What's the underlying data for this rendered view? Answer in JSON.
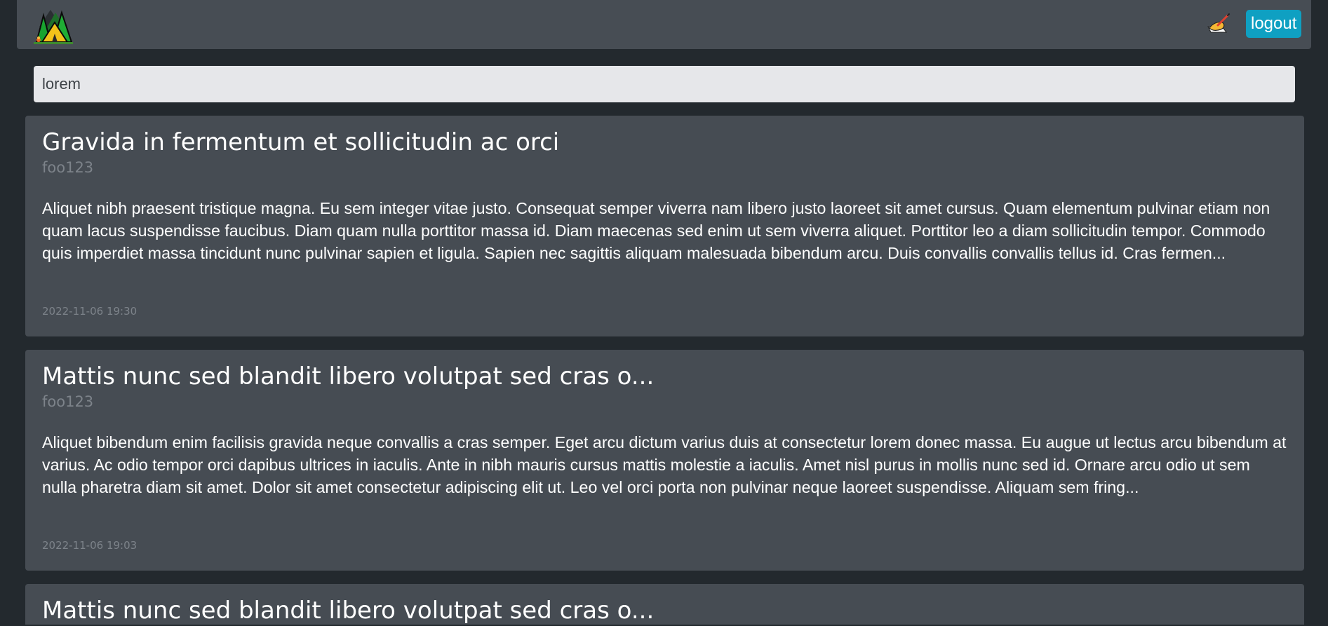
{
  "header": {
    "logout_label": "logout"
  },
  "search": {
    "value": "lorem"
  },
  "posts": [
    {
      "title": "Gravida in fermentum et sollicitudin ac orci",
      "author": "foo123",
      "excerpt": "Aliquet nibh praesent tristique magna. Eu sem integer vitae justo. Consequat semper viverra nam libero justo laoreet sit amet cursus. Quam elementum pulvinar etiam non quam lacus suspendisse faucibus. Diam quam nulla porttitor massa id. Diam maecenas sed enim ut sem viverra aliquet. Porttitor leo a diam sollicitudin tempor. Commodo quis imperdiet massa tincidunt nunc pulvinar sapien et ligula. Sapien nec sagittis aliquam malesuada bibendum arcu. Duis convallis convallis tellus id. Cras fermen...",
      "date": "2022-11-06 19:30"
    },
    {
      "title": "Mattis nunc sed blandit libero volutpat sed cras o...",
      "author": "foo123",
      "excerpt": "Aliquet bibendum enim facilisis gravida neque convallis a cras semper. Eget arcu dictum varius duis at consectetur lorem donec massa. Eu augue ut lectus arcu bibendum at varius. Ac odio tempor orci dapibus ultrices in iaculis. Ante in nibh mauris cursus mattis molestie a iaculis. Amet nisl purus in mollis nunc sed id. Ornare arcu odio ut sem nulla pharetra diam sit amet. Dolor sit amet consectetur adipiscing elit ut. Leo vel orci porta non pulvinar neque laoreet suspendisse. Aliquam sem fring...",
      "date": "2022-11-06 19:03"
    },
    {
      "title": "Mattis nunc sed blandit libero volutpat sed cras o..."
    }
  ],
  "colors": {
    "page_background": "#23292e",
    "panel_background": "#464c53",
    "accent": "#0fa0c2",
    "muted_text": "#7d838a"
  },
  "icons": {
    "logo": "camping-tent-icon",
    "write": "writing-hand-icon"
  }
}
